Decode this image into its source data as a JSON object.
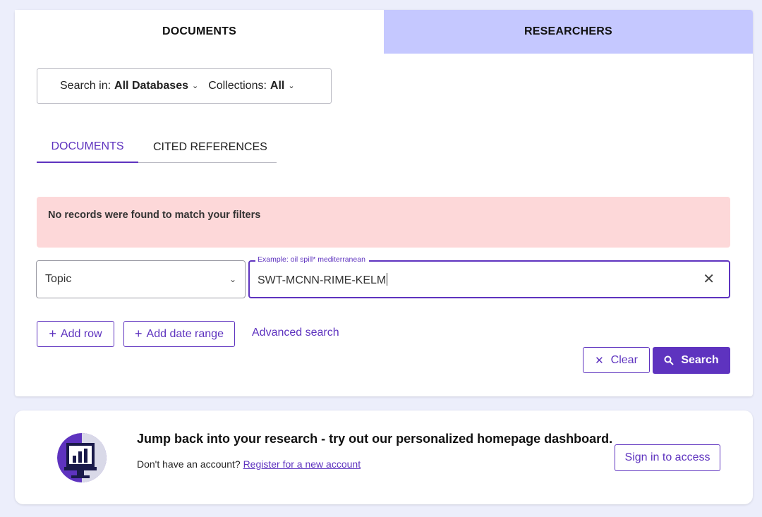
{
  "top_tabs": {
    "documents": "DOCUMENTS",
    "researchers": "RESEARCHERS"
  },
  "db_selector": {
    "search_in_label": "Search in:",
    "search_in_value": "All Databases",
    "collections_label": "Collections:",
    "collections_value": "All"
  },
  "sub_tabs": {
    "documents": "DOCUMENTS",
    "cited_references": "CITED REFERENCES"
  },
  "alert": {
    "message": "No records were found to match your filters"
  },
  "search_row": {
    "field": "Topic",
    "legend": "Example: oil spill* mediterranean",
    "value": "SWT-MCNN-RIME-KELM"
  },
  "actions": {
    "add_row": "Add row",
    "add_date_range": "Add date range",
    "advanced_search": "Advanced search",
    "clear": "Clear",
    "search": "Search"
  },
  "banner": {
    "title": "Jump back into your research - try out our personalized homepage dashboard.",
    "no_account": "Don't have an account?",
    "register_link": "Register for a new account",
    "sign_in": "Sign in to access"
  },
  "colors": {
    "accent": "#5e33bf",
    "tab_inactive": "#c5c8ff",
    "alert_bg": "#fdd8d9",
    "page_bg": "#eceefb"
  }
}
